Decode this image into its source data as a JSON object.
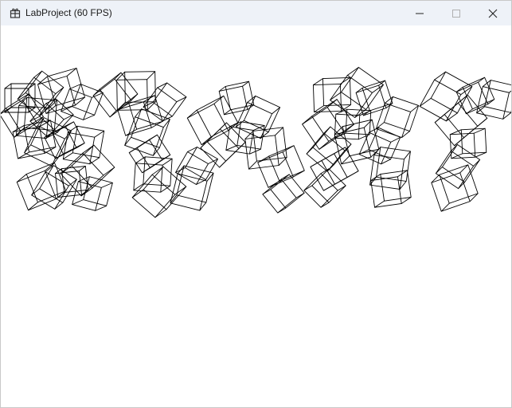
{
  "window": {
    "title": "LabProject (60 FPS)"
  },
  "icons": {
    "app": "app-icon",
    "minimize": "minimize-icon",
    "maximize": "maximize-icon",
    "close": "close-icon"
  },
  "colors": {
    "titlebar_bg": "#eef2f8",
    "viewport_bg": "#ffffff",
    "wireframe": "#000000"
  }
}
